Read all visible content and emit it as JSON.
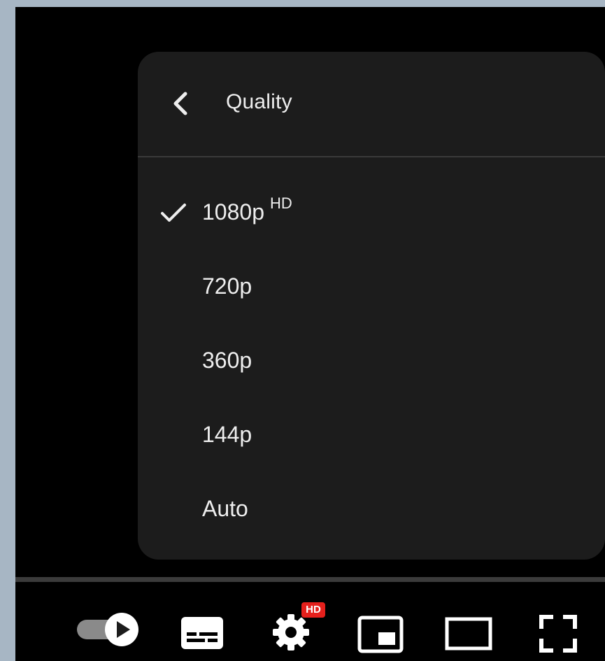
{
  "quality_menu": {
    "title": "Quality",
    "back_icon": "chevron-left-icon",
    "selected": "1080p",
    "options": [
      {
        "label": "1080p",
        "badge": "HD",
        "selected": true
      },
      {
        "label": "720p",
        "badge": "",
        "selected": false
      },
      {
        "label": "360p",
        "badge": "",
        "selected": false
      },
      {
        "label": "144p",
        "badge": "",
        "selected": false
      },
      {
        "label": "Auto",
        "badge": "",
        "selected": false
      }
    ]
  },
  "controls": {
    "autoplay_icon": "autoplay-toggle-icon",
    "subtitles_icon": "subtitles-icon",
    "settings_icon": "gear-icon",
    "settings_badge": "HD",
    "miniplayer_icon": "miniplayer-icon",
    "theater_icon": "theater-mode-icon",
    "fullscreen_icon": "fullscreen-icon"
  },
  "colors": {
    "menu_background": "#1c1c1c",
    "player_background": "#000000",
    "text": "#eeeeee",
    "badge_red": "#e5201c",
    "page_background": "#a7b6c4"
  }
}
